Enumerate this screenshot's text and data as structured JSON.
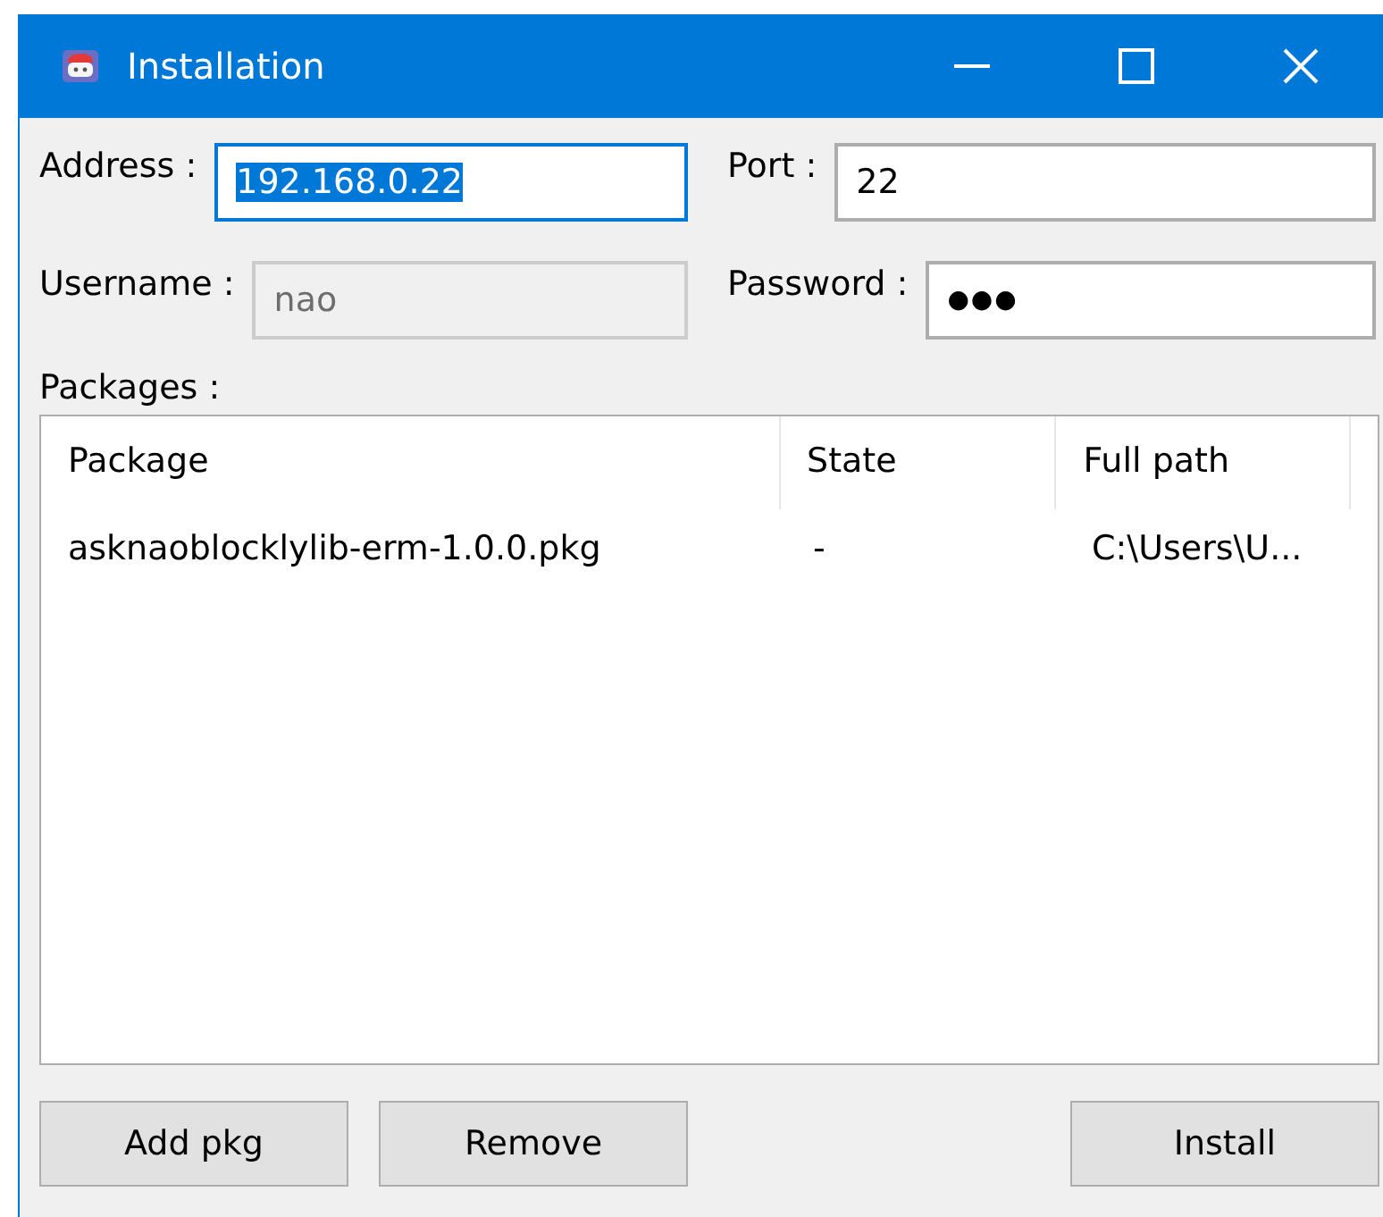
{
  "window": {
    "title": "Installation"
  },
  "fields": [
    {
      "label": "Address :",
      "value": "192.168.0.22",
      "kind": "text",
      "focused": true,
      "text_selected": true,
      "disabled": false
    },
    {
      "label": "Port :",
      "value": "22",
      "kind": "text",
      "focused": false,
      "text_selected": false,
      "disabled": false
    },
    {
      "label": "Username :",
      "value": "nao",
      "kind": "text",
      "focused": false,
      "text_selected": false,
      "disabled": true
    },
    {
      "label": "Password :",
      "value": "●●●",
      "kind": "password",
      "focused": false,
      "text_selected": false,
      "disabled": false
    }
  ],
  "packages": {
    "label": "Packages :",
    "columns": [
      "Package",
      "State",
      "Full path"
    ],
    "rows": [
      [
        "asknaoblocklylib-erm-1.0.0.pkg",
        "-",
        "C:\\Users\\U..."
      ]
    ]
  },
  "buttons": {
    "left": [
      "Add pkg",
      "Remove"
    ],
    "right": [
      "Install"
    ]
  }
}
